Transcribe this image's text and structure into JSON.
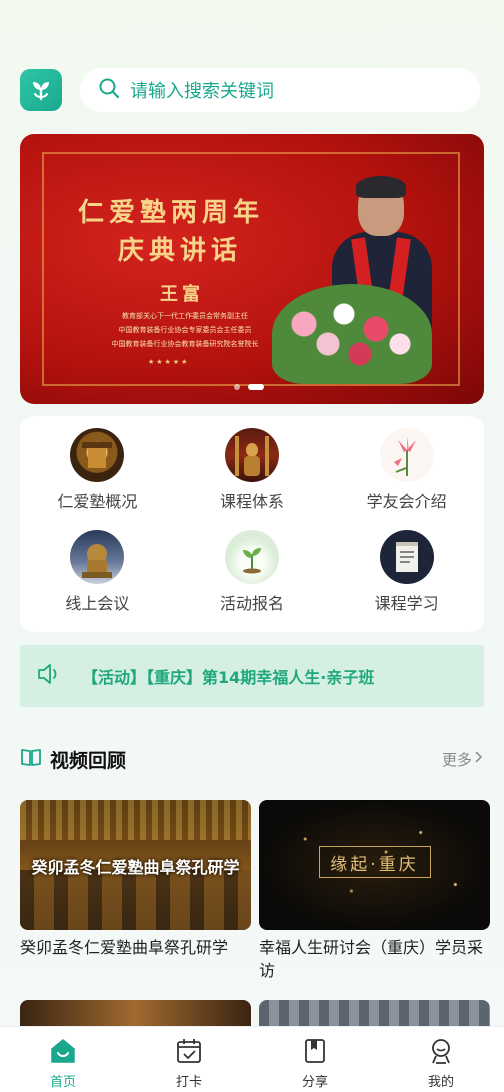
{
  "search": {
    "placeholder": "请输入搜索关键词"
  },
  "banner": {
    "title_line1": "仁爱塾两周年",
    "title_line2": "庆典讲话",
    "speaker_name": "王富",
    "captions": [
      "教育部关心下一代工作委员会常务副主任",
      "中国教育装备行业协会专家委员会主任委员",
      "中国教育装备行业协会教育装备研究院名誉院长"
    ],
    "stars": "★★★★★",
    "slide_count": 2,
    "active_slide": 2
  },
  "menu": {
    "items": [
      {
        "label": "仁爱塾概况",
        "icon": "temple-hall-icon"
      },
      {
        "label": "课程体系",
        "icon": "confucius-statue-icon"
      },
      {
        "label": "学友会介绍",
        "icon": "lily-flower-icon"
      },
      {
        "label": "线上会议",
        "icon": "lion-statue-icon"
      },
      {
        "label": "活动报名",
        "icon": "sprout-icon"
      },
      {
        "label": "课程学习",
        "icon": "book-icon"
      }
    ]
  },
  "notice": {
    "text": "【活动】【重庆】第14期幸福人生·亲子班"
  },
  "videos_section": {
    "title": "视频回顾",
    "more_label": "更多",
    "videos": [
      {
        "title": "癸卯孟冬仁爱塾曲阜祭孔研学",
        "overlay": "癸卯孟冬仁爱塾曲阜祭孔研学"
      },
      {
        "title": "幸福人生研讨会（重庆）学员采访",
        "overlay": "缘起·重庆"
      }
    ]
  },
  "tabbar": {
    "tabs": [
      {
        "label": "首页",
        "active": true
      },
      {
        "label": "打卡",
        "active": false
      },
      {
        "label": "分享",
        "active": false
      },
      {
        "label": "我的",
        "active": false
      }
    ]
  },
  "colors": {
    "accent": "#1aa88c",
    "notice_bg": "#d6efe3",
    "banner_red": "#c41a16"
  }
}
